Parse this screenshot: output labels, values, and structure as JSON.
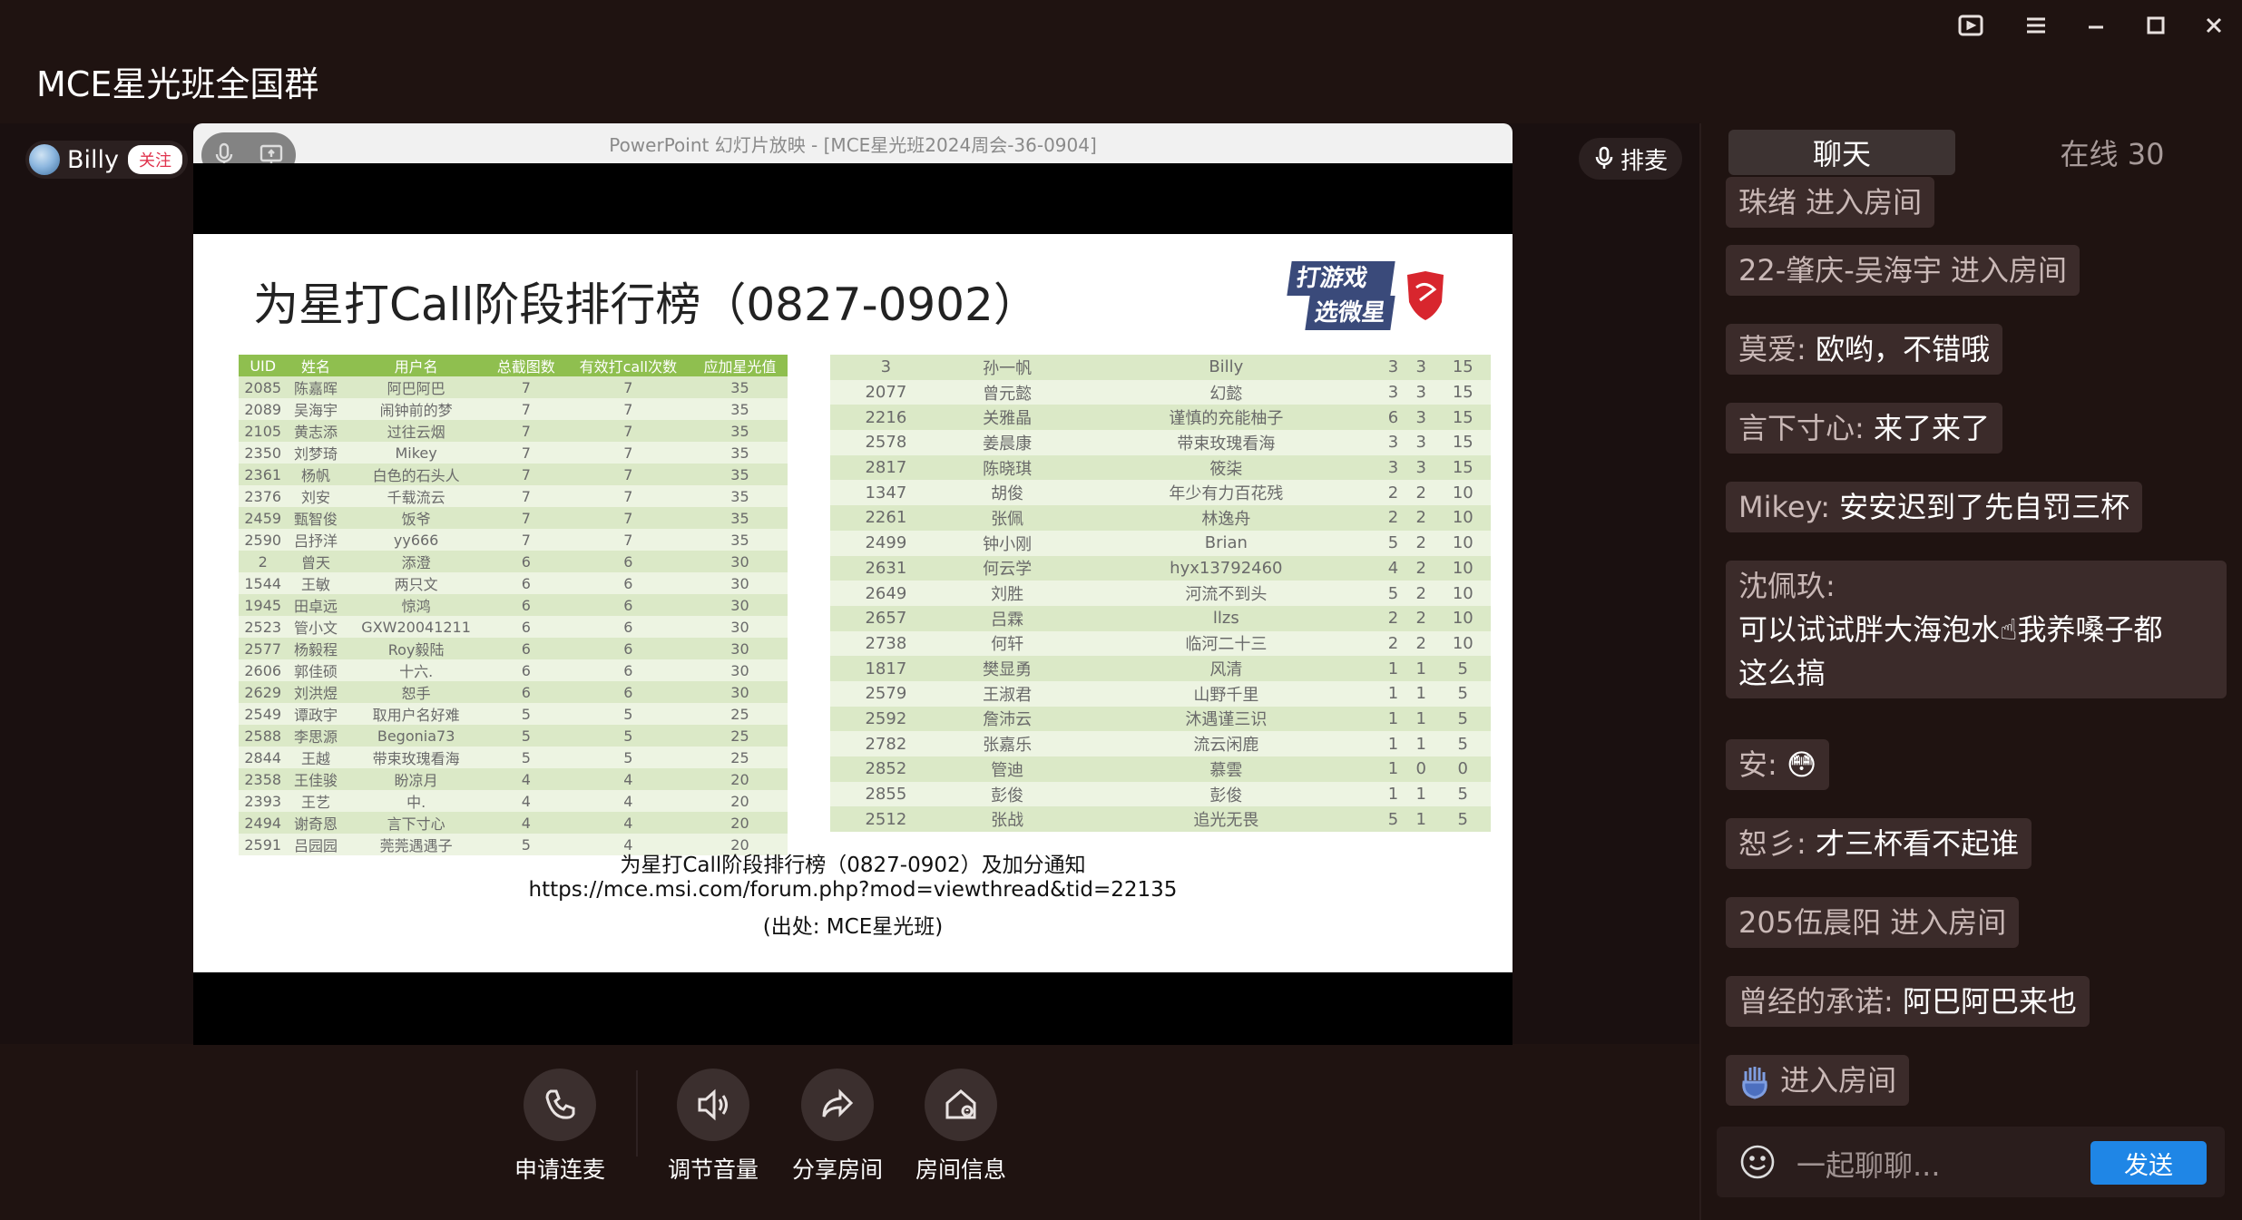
{
  "window": {
    "title": "MCE星光班全国群"
  },
  "host": {
    "name": "Billy",
    "follow_label": "关注"
  },
  "queue_label": "排麦",
  "ppt": {
    "window_title": "PowerPoint 幻灯片放映 - [MCE星光班2024周会-36-0904]",
    "slide_title": "为星打Call阶段排行榜（0827-0902）",
    "logo_text_1": "打游戏",
    "logo_text_2": "选微星",
    "left_table": {
      "headers": [
        "UID",
        "姓名",
        "用户名",
        "总截图数",
        "有效打call次数",
        "应加星光值"
      ],
      "rows": [
        [
          "2085",
          "陈嘉晖",
          "阿巴阿巴",
          "7",
          "7",
          "35"
        ],
        [
          "2089",
          "吴海宇",
          "闹钟前的梦",
          "7",
          "7",
          "35"
        ],
        [
          "2105",
          "黄志添",
          "过往云烟",
          "7",
          "7",
          "35"
        ],
        [
          "2350",
          "刘梦琦",
          "Mikey",
          "7",
          "7",
          "35"
        ],
        [
          "2361",
          "杨帆",
          "白色的石头人",
          "7",
          "7",
          "35"
        ],
        [
          "2376",
          "刘安",
          "千载流云",
          "7",
          "7",
          "35"
        ],
        [
          "2459",
          "甄智俊",
          "饭爷",
          "7",
          "7",
          "35"
        ],
        [
          "2590",
          "吕抒洋",
          "yy666",
          "7",
          "7",
          "35"
        ],
        [
          "2",
          "曾天",
          "添澄",
          "6",
          "6",
          "30"
        ],
        [
          "1544",
          "王敏",
          "两只文",
          "6",
          "6",
          "30"
        ],
        [
          "1945",
          "田卓远",
          "惊鸿",
          "6",
          "6",
          "30"
        ],
        [
          "2523",
          "管小文",
          "GXW20041211",
          "6",
          "6",
          "30"
        ],
        [
          "2577",
          "杨毅程",
          "Roy毅陆",
          "6",
          "6",
          "30"
        ],
        [
          "2606",
          "郭佳硕",
          "十六.",
          "6",
          "6",
          "30"
        ],
        [
          "2629",
          "刘洪煜",
          "恕手",
          "6",
          "6",
          "30"
        ],
        [
          "2549",
          "谭政宇",
          "取用户名好难",
          "5",
          "5",
          "25"
        ],
        [
          "2588",
          "李思源",
          "Begonia73",
          "5",
          "5",
          "25"
        ],
        [
          "2844",
          "王越",
          "带束玫瑰看海",
          "5",
          "5",
          "25"
        ],
        [
          "2358",
          "王佳骏",
          "盼凉月",
          "4",
          "4",
          "20"
        ],
        [
          "2393",
          "王艺",
          "中.",
          "4",
          "4",
          "20"
        ],
        [
          "2494",
          "谢奇恩",
          "言下寸心",
          "4",
          "4",
          "20"
        ],
        [
          "2591",
          "吕园园",
          "莞莞遇遇子",
          "5",
          "4",
          "20"
        ]
      ]
    },
    "right_table": {
      "rows": [
        [
          "3",
          "孙一帆",
          "Billy",
          "3",
          "3",
          "15"
        ],
        [
          "2077",
          "曾元懿",
          "幻懿",
          "3",
          "3",
          "15"
        ],
        [
          "2216",
          "关雅晶",
          "谨慎的充能柚子",
          "6",
          "3",
          "15"
        ],
        [
          "2578",
          "姜晨康",
          "带束玫瑰看海",
          "3",
          "3",
          "15"
        ],
        [
          "2817",
          "陈晓琪",
          "筱柒",
          "3",
          "3",
          "15"
        ],
        [
          "1347",
          "胡俊",
          "年少有力百花残",
          "2",
          "2",
          "10"
        ],
        [
          "2261",
          "张佩",
          "林逸舟",
          "2",
          "2",
          "10"
        ],
        [
          "2499",
          "钟小刚",
          "Brian",
          "5",
          "2",
          "10"
        ],
        [
          "2631",
          "何云学",
          "hyx13792460",
          "4",
          "2",
          "10"
        ],
        [
          "2649",
          "刘胜",
          "河流不到头",
          "5",
          "2",
          "10"
        ],
        [
          "2657",
          "吕霖",
          "llzs",
          "2",
          "2",
          "10"
        ],
        [
          "2738",
          "何轩",
          "临河二十三",
          "2",
          "2",
          "10"
        ],
        [
          "1817",
          "樊显勇",
          "风清",
          "1",
          "1",
          "5"
        ],
        [
          "2579",
          "王淑君",
          "山野千里",
          "1",
          "1",
          "5"
        ],
        [
          "2592",
          "詹沛云",
          "沐遇谨三识",
          "1",
          "1",
          "5"
        ],
        [
          "2782",
          "张嘉乐",
          "流云闲鹿",
          "1",
          "1",
          "5"
        ],
        [
          "2852",
          "管迪",
          "慕雲",
          "1",
          "0",
          "0"
        ],
        [
          "2855",
          "彭俊",
          "彭俊",
          "1",
          "1",
          "5"
        ],
        [
          "2512",
          "张战",
          "追光无畏",
          "5",
          "1",
          "5"
        ]
      ]
    },
    "note_line_1": "为星打Call阶段排行榜（0827-0902）及加分通知",
    "note_line_2": "https://mce.msi.com/forum.php?mod=viewthread&tid=22135",
    "note_line_3": "(出处: MCE星光班)"
  },
  "actions": {
    "call": "申请连麦",
    "volume": "调节音量",
    "share": "分享房间",
    "info": "房间信息"
  },
  "chat": {
    "tab_chat": "聊天",
    "tab_online": "在线 30",
    "messages": [
      {
        "text": "珠绪 进入房间"
      },
      {
        "text": "22-肇庆-吴海宇 进入房间"
      },
      {
        "who": "莫爱:",
        "text": "欧哟，不错哦"
      },
      {
        "who": "言下寸心:",
        "text": "来了来了"
      },
      {
        "who": "Mikey:",
        "text": "安安迟到了先自罚三杯"
      },
      {
        "who": "沈佩玖:",
        "line1": "可以试试胖大海泡水☝我养嗓子都",
        "line2": "这么搞"
      },
      {
        "who": "安:",
        "text": "😳"
      },
      {
        "who": "恕彡:",
        "text": "才三杯看不起谁"
      },
      {
        "text": "205伍晨阳 进入房间"
      },
      {
        "who": "曾经的承诺:",
        "text": "阿巴阿巴来也"
      },
      {
        "text": "进入房间"
      }
    ],
    "input_placeholder": "一起聊聊...",
    "send_label": "发送"
  }
}
